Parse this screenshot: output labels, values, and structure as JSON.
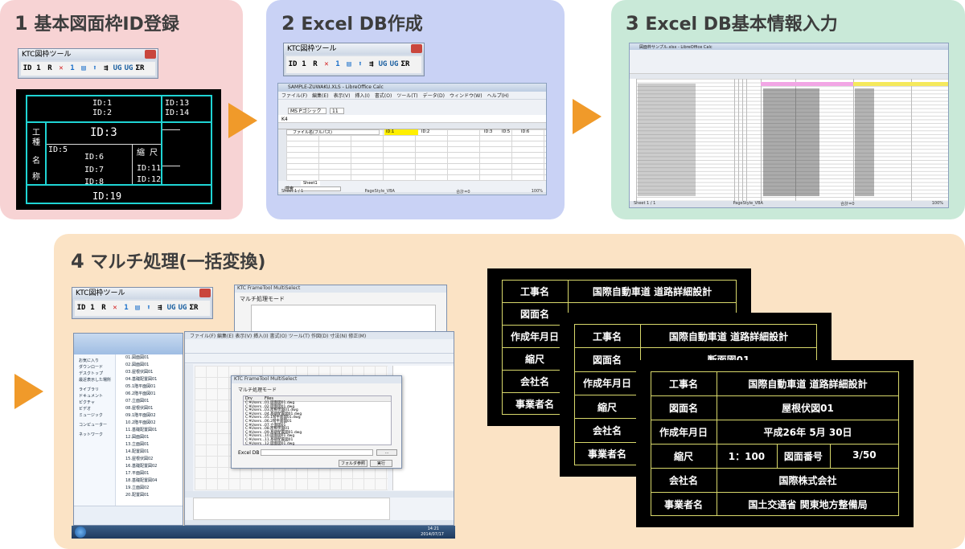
{
  "panels": {
    "p1": {
      "num": "1",
      "title": "基本図面枠ID登録"
    },
    "p2": {
      "num": "2",
      "title": "Excel DB作成"
    },
    "p3": {
      "num": "3",
      "title": "Excel DB基本情報入力"
    },
    "p4": {
      "num": "4",
      "title": "マルチ処理(一括変換)"
    }
  },
  "toolbar": {
    "title": "KTC図枠ツール",
    "buttons": [
      "ID",
      "1",
      "R",
      "✕",
      "1",
      "▤",
      "⬆",
      "⇶",
      "UG",
      "UG",
      "ΣR"
    ]
  },
  "cad_frame": {
    "id1": "ID:1",
    "id2": "ID:2",
    "id3": "ID:3",
    "id5": "ID:5",
    "id6": "ID:6",
    "id7": "ID:7",
    "id8": "ID:8",
    "id11": "ID:11",
    "id12": "ID:12",
    "id13": "ID:13",
    "id14": "ID:14",
    "id19": "ID:19",
    "label_koushu": [
      "工",
      "種"
    ],
    "label_mei": [
      "名",
      "称"
    ],
    "label_shukushaku": "縮 尺"
  },
  "excel2": {
    "file_title": "SAMPLE-ZUWAKU.XLS - LibreOffice Calc",
    "menu": [
      "ファイル(F)",
      "編集(E)",
      "表示(V)",
      "挿入(I)",
      "書式(O)",
      "ツール(T)",
      "データ(D)",
      "ウィンドウ(W)",
      "ヘルプ(H)"
    ],
    "cell_ref": "K4",
    "font": "MS Pゴシック",
    "size": "11",
    "header_a": "ファイル名(フルパス)",
    "header_e": "ID:1",
    "header_f": "ID:2",
    "header_g": "ID:3",
    "header_h": "ID:5",
    "header_i": "ID:6",
    "sheet_tab": "Sheet1",
    "search": "検索",
    "status": [
      "Sheet 1 / 1",
      "PageStyle_VBA",
      "合計=0",
      "100%"
    ]
  },
  "excel3": {
    "file_title": "図面枠サンプル.xlsx - LibreOffice Calc",
    "status": [
      "Sheet 1 / 1",
      "PageStyle_VBA",
      "合計=0",
      "100%"
    ]
  },
  "multi": {
    "dialog_title": "KTC FrameTool MultiSelect",
    "dialog_caption": "マルチ処理モード",
    "cols": [
      "Drv",
      "Files"
    ],
    "excel_label": "Excel DB",
    "buttons": [
      "フォルダ参照",
      "実行"
    ],
    "bg_title": "KTC FrameTool MultiSelect",
    "bg_caption": "マルチ処理モード",
    "folder": "フォルダー",
    "taskbar_time": "14:21",
    "taskbar_date": "2014/07/17",
    "explorer_items": [
      "お気に入り",
      "ダウンロード",
      "デスクトップ",
      "最近表示した場所",
      "ライブラリ",
      "ドキュメント",
      "ピクチャ",
      "ビデオ",
      "ミュージック",
      "コンピューター",
      "ネットワーク"
    ],
    "file_list": [
      "01.図面図01",
      "02.図面図01",
      "03.屋根伏図01",
      "04.基礎配置図01",
      "05.1階平面図01",
      "06.2階平面図01",
      "07.立面図01",
      "08.屋根伏図01",
      "09.1階平面図02",
      "10.2階平面図02",
      "11.基礎配置図01",
      "12.図面図01",
      "13.立面図01",
      "14.配置図01",
      "15.屋根伏図02",
      "16.基礎配置図02",
      "17.平面図01",
      "18.基礎配置図04",
      "19.立面図02",
      "20.配置図01"
    ],
    "dlg_files": [
      "01.図面図01.dwg",
      "02.図面図01.dwg",
      "03.屋根伏図01.dwg",
      "04.基礎配置図01.dwg",
      "05.1階平面図01.dwg",
      "06.2階平面図01",
      "07.立面図01",
      "08.屋根伏図01",
      "09.基礎配置図01.dwg",
      "10.図面図01.dwg",
      "11.基礎配置図01",
      "12.図面図01.dwg"
    ],
    "drv": "C:¥Users..."
  },
  "titleblocks": [
    {
      "rows": [
        [
          "工事名",
          "国際自動車道 道路詳細設計"
        ],
        [
          "図面名",
          ""
        ],
        [
          "作成年月日",
          ""
        ],
        [
          "縮尺",
          ""
        ],
        [
          "会社名",
          ""
        ],
        [
          "事業者名",
          ""
        ]
      ]
    },
    {
      "rows": [
        [
          "工事名",
          "国際自動車道 道路詳細設計"
        ],
        [
          "図面名",
          "断面図01"
        ],
        [
          "作成年月日",
          ""
        ],
        [
          "縮尺",
          ""
        ],
        [
          "会社名",
          ""
        ],
        [
          "事業者名",
          ""
        ]
      ]
    },
    {
      "rows": [
        [
          "工事名",
          "国際自動車道 道路詳細設計"
        ],
        [
          "図面名",
          "屋根伏図01"
        ],
        [
          "作成年月日",
          "平成26年 5月 30日"
        ],
        [
          "縮尺",
          "1：100"
        ],
        [
          "会社名",
          "国際株式会社"
        ],
        [
          "事業者名",
          "国土交通省 関東地方整備局"
        ]
      ],
      "scale_extra_label": "図面番号",
      "scale_extra_value": "3/50"
    }
  ],
  "colors": {
    "panel1": "#f7d3d4",
    "panel2": "#c9d2f5",
    "panel3": "#c9e9d8",
    "panel4": "#fbe3c5",
    "arrow": "#f09a2a",
    "cyan": "#1fd4d4",
    "yellow_line": "#d8d86b"
  }
}
